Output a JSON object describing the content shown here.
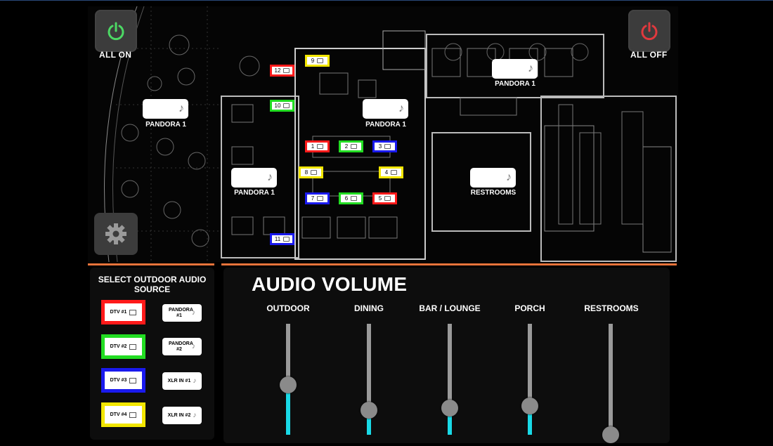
{
  "power": {
    "on_label": "ALL ON",
    "off_label": "ALL OFF",
    "on_color": "#4cd964",
    "off_color": "#e0393e"
  },
  "zones": [
    {
      "label": "PANDORA 1"
    },
    {
      "label": "PANDORA 1"
    },
    {
      "label": "PANDORA 1"
    },
    {
      "label": "PANDORA 1"
    },
    {
      "label": "RESTROOMS"
    }
  ],
  "tvs": [
    {
      "number": "1",
      "color": "red"
    },
    {
      "number": "2",
      "color": "green"
    },
    {
      "number": "3",
      "color": "blue"
    },
    {
      "number": "4",
      "color": "yellow"
    },
    {
      "number": "5",
      "color": "red"
    },
    {
      "number": "6",
      "color": "green"
    },
    {
      "number": "7",
      "color": "blue"
    },
    {
      "number": "8",
      "color": "yellow"
    },
    {
      "number": "9",
      "color": "yellow"
    },
    {
      "number": "10",
      "color": "green"
    },
    {
      "number": "11",
      "color": "blue"
    },
    {
      "number": "12",
      "color": "red"
    }
  ],
  "colors": {
    "red": "#ff1a1a",
    "green": "#22dd22",
    "blue": "#1a1aee",
    "yellow": "#f2e600",
    "accent": "#e8743b",
    "volume_fill": "#19d9e6"
  },
  "source": {
    "title": "SELECT OUTDOOR AUDIO SOURCE",
    "dtv": [
      {
        "label": "DTV #1",
        "color": "red"
      },
      {
        "label": "DTV #2",
        "color": "green"
      },
      {
        "label": "DTV #3",
        "color": "blue"
      },
      {
        "label": "DTV #4",
        "color": "yellow"
      }
    ],
    "alt": [
      {
        "label": "PANDORA #1"
      },
      {
        "label": "PANDORA #2"
      },
      {
        "label": "XLR IN #1"
      },
      {
        "label": "XLR IN #2"
      }
    ]
  },
  "volume": {
    "title": "AUDIO VOLUME",
    "channels": [
      {
        "label": "OUTDOOR",
        "level": 0.45
      },
      {
        "label": "DINING",
        "level": 0.22
      },
      {
        "label": "BAR / LOUNGE",
        "level": 0.24
      },
      {
        "label": "PORCH",
        "level": 0.26
      },
      {
        "label": "RESTROOMS",
        "level": 0.0
      }
    ]
  }
}
